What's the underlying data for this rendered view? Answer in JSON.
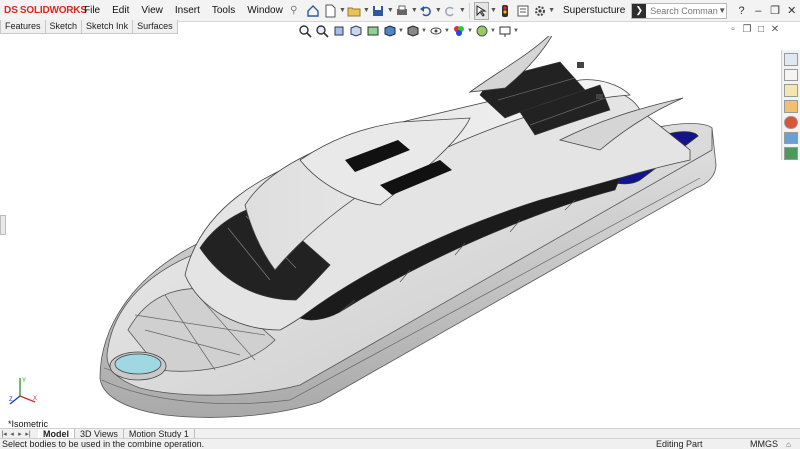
{
  "app": {
    "logo_prefix": "DS",
    "logo_name": "SOLIDWORKS"
  },
  "menu": [
    "File",
    "Edit",
    "View",
    "Insert",
    "Tools",
    "Window"
  ],
  "document": {
    "title": "Superstucture"
  },
  "search": {
    "placeholder": "Search Commands"
  },
  "command_tabs": [
    "Features",
    "Sketch",
    "Sketch Ink",
    "Surfaces"
  ],
  "viewport": {
    "view_orientation": "*Isometric"
  },
  "bottom_tabs": [
    {
      "label": "Model",
      "active": true
    },
    {
      "label": "3D Views",
      "active": false
    },
    {
      "label": "Motion Study 1",
      "active": false
    }
  ],
  "status": {
    "message": "Select bodies to be used in the combine operation.",
    "mode": "Editing Part",
    "units": "MMGS"
  },
  "colors": {
    "brand_red": "#d52b1e",
    "body_gray": "#d6d6d6",
    "glass": "#1b1b1b",
    "solar_panel": "#14148a",
    "pool_water": "#9fd8e0"
  }
}
